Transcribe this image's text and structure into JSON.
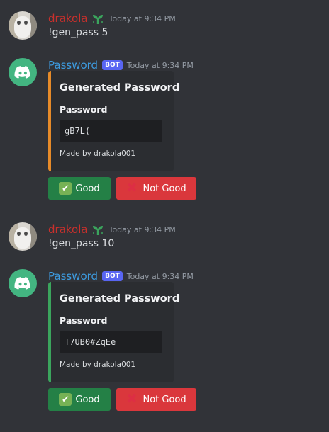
{
  "messages": [
    {
      "type": "user",
      "username": "drakola",
      "timestamp": "Today at 9:34 PM",
      "content": "!gen_pass 5"
    },
    {
      "type": "bot",
      "username": "Password",
      "bot_tag": "BOT",
      "timestamp": "Today at 9:34 PM",
      "embed": {
        "title": "Generated Password",
        "field_name": "Password",
        "field_value": "gB7L(",
        "footer": "Made by drakola001",
        "color": "#e78b29"
      },
      "buttons": {
        "good_label": "Good",
        "bad_label": "Not Good"
      }
    },
    {
      "type": "user",
      "username": "drakola",
      "timestamp": "Today at 9:34 PM",
      "content": "!gen_pass 10"
    },
    {
      "type": "bot",
      "username": "Password",
      "bot_tag": "BOT",
      "timestamp": "Today at 9:34 PM",
      "embed": {
        "title": "Generated Password",
        "field_name": "Password",
        "field_value": "T7UB0#ZqEe",
        "footer": "Made by drakola001",
        "color": "#3ba55d"
      },
      "buttons": {
        "good_label": "Good",
        "bad_label": "Not Good"
      }
    }
  ],
  "colors": {
    "background": "#313338",
    "embed_bg": "#2b2d31",
    "good_button": "#248046",
    "bad_button": "#da373c",
    "username_user": "#c9302c",
    "username_bot": "#3d9bdf",
    "bot_tag": "#5865f2"
  },
  "icons": {
    "user_badge": "sprout-icon",
    "bot_avatar": "discord-logo-icon",
    "good_button": "check-mark-icon",
    "bad_button": "cross-mark-icon"
  }
}
